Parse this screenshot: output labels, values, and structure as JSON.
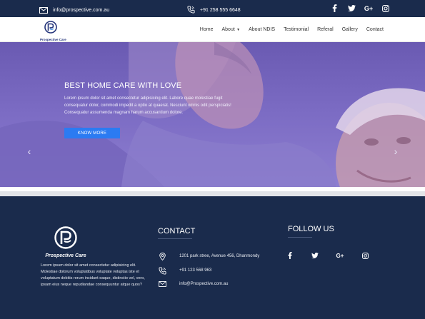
{
  "topbar": {
    "email": "info@prospective.com.au",
    "phone": "+91 258 555 6648",
    "social": [
      {
        "icon": "facebook-icon",
        "glyph": "f"
      },
      {
        "icon": "twitter-icon",
        "glyph": "t"
      },
      {
        "icon": "google-plus-icon",
        "glyph": "G+"
      },
      {
        "icon": "instagram-icon",
        "glyph": ""
      }
    ]
  },
  "navbar": {
    "logo_text": "Prospective Care",
    "items": [
      "Home",
      "About",
      "About NDIS",
      "Testimonial",
      "Referal",
      "Gallery",
      "Contact"
    ]
  },
  "hero": {
    "title": "BEST HOME CARE WITH LOVE",
    "body": "Lorem ipsum dolor sit amet consectetur adipisicing elit. Labore quae molestiae fugit consequatur dolor, commodi impedit a optio at quaerat. Nesciunt omnis odit perspiciatis! Consequatur assumenda magnam harum accusantium dolore.",
    "button": "KNOW MORE",
    "prev": "‹",
    "next": "›"
  },
  "footer": {
    "logo_text": "Prospective Care",
    "about": "Lorem ipsum dolor sit amet consectetur adipisicing elit. Molestiae dolorum voluptatibus voluptate voluptas iste et voluptatum debitis rerum incidunt eaque, distinctio vel, vero, ipsam eius neque repudiandae consequuntur atque quos?",
    "contact_title": "CONTACT",
    "address": "1201 park stree, Avenue 456, Dhanmondy",
    "phone": "+91 123 568 963",
    "email": "info@Prospective.com.au",
    "follow_title": "FOLLOW US"
  },
  "colors": {
    "navy": "#1a2b4c",
    "accent_blue": "#2b7bf2",
    "hero_purple": "#7c6cc4"
  }
}
